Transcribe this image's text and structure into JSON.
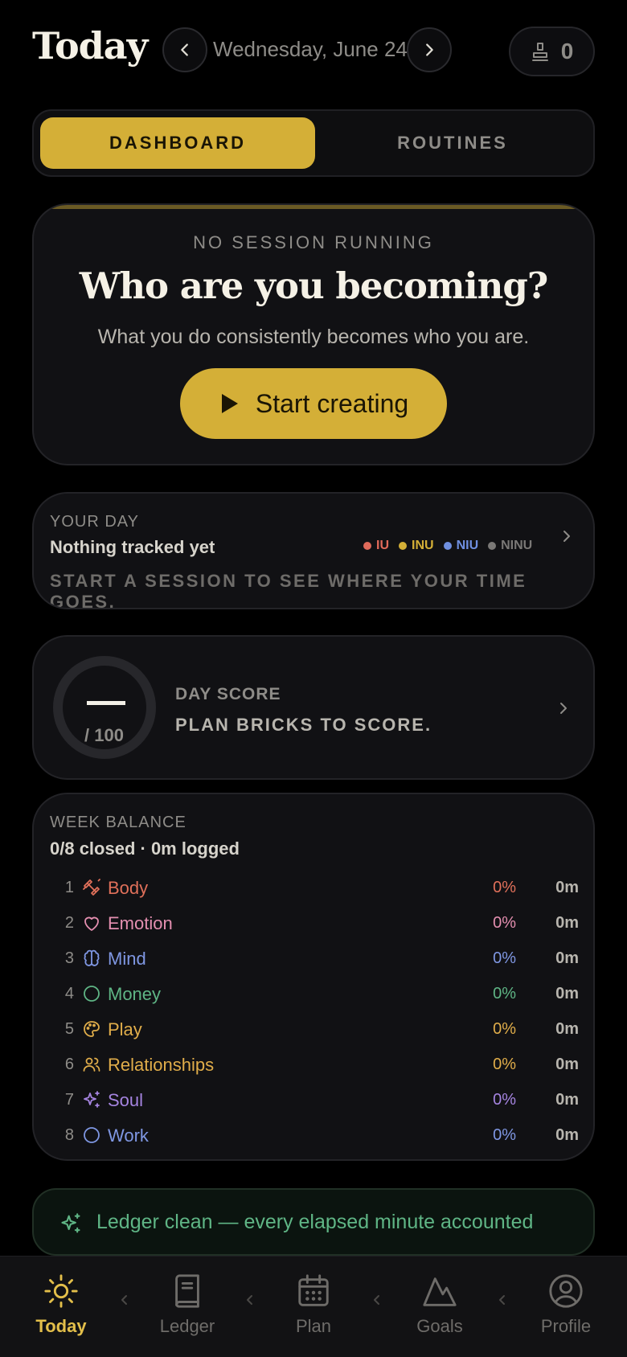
{
  "header": {
    "title": "Today",
    "date": "Wednesday, June 24",
    "counter": "0"
  },
  "segments": {
    "active": "DASHBOARD",
    "inactive": "ROUTINES"
  },
  "hero": {
    "label": "NO SESSION RUNNING",
    "title": "Who are you becoming?",
    "subtitle": "What you do consistently becomes who you are.",
    "button": "Start creating"
  },
  "your_day": {
    "label": "YOUR DAY",
    "status": "Nothing tracked yet",
    "hint": "START A SESSION TO SEE WHERE YOUR TIME GOES.",
    "legend": [
      {
        "label": "IU",
        "color": "#e06a5a"
      },
      {
        "label": "INU",
        "color": "#d4af37"
      },
      {
        "label": "NIU",
        "color": "#6f8fe0"
      },
      {
        "label": "NINU",
        "color": "#7a7876"
      }
    ]
  },
  "day_score": {
    "value": "—",
    "denominator": "/ 100",
    "label": "DAY SCORE",
    "hint": "PLAN BRICKS TO SCORE."
  },
  "week_balance": {
    "label": "WEEK BALANCE",
    "summary": "0/8 closed · 0m logged",
    "rows": [
      {
        "num": "1",
        "name": "Body",
        "pct": "0%",
        "min": "0m",
        "color": "#e0705a",
        "icon": "dumbbell-icon"
      },
      {
        "num": "2",
        "name": "Emotion",
        "pct": "0%",
        "min": "0m",
        "color": "#e48fb0",
        "icon": "heart-icon"
      },
      {
        "num": "3",
        "name": "Mind",
        "pct": "0%",
        "min": "0m",
        "color": "#7f97e3",
        "icon": "brain-icon"
      },
      {
        "num": "4",
        "name": "Money",
        "pct": "0%",
        "min": "0m",
        "color": "#5fb585",
        "icon": "circle-icon"
      },
      {
        "num": "5",
        "name": "Play",
        "pct": "0%",
        "min": "0m",
        "color": "#e0ad4a",
        "icon": "palette-icon"
      },
      {
        "num": "6",
        "name": "Relationships",
        "pct": "0%",
        "min": "0m",
        "color": "#e0ad4a",
        "icon": "users-icon"
      },
      {
        "num": "7",
        "name": "Soul",
        "pct": "0%",
        "min": "0m",
        "color": "#a584e0",
        "icon": "sparkles-icon"
      },
      {
        "num": "8",
        "name": "Work",
        "pct": "0%",
        "min": "0m",
        "color": "#7f97e3",
        "icon": "circle-icon"
      }
    ]
  },
  "ledger": {
    "message": "Ledger clean — every elapsed minute accounted"
  },
  "tabs": [
    {
      "label": "Today",
      "icon": "sun-icon",
      "active": true
    },
    {
      "label": "Ledger",
      "icon": "book-icon",
      "active": false
    },
    {
      "label": "Plan",
      "icon": "calendar-icon",
      "active": false
    },
    {
      "label": "Goals",
      "icon": "mountain-icon",
      "active": false
    },
    {
      "label": "Profile",
      "icon": "user-circle-icon",
      "active": false
    }
  ],
  "colors": {
    "accent": "#d4af37",
    "background": "#000000",
    "card": "#111114",
    "success": "#5fb585"
  }
}
